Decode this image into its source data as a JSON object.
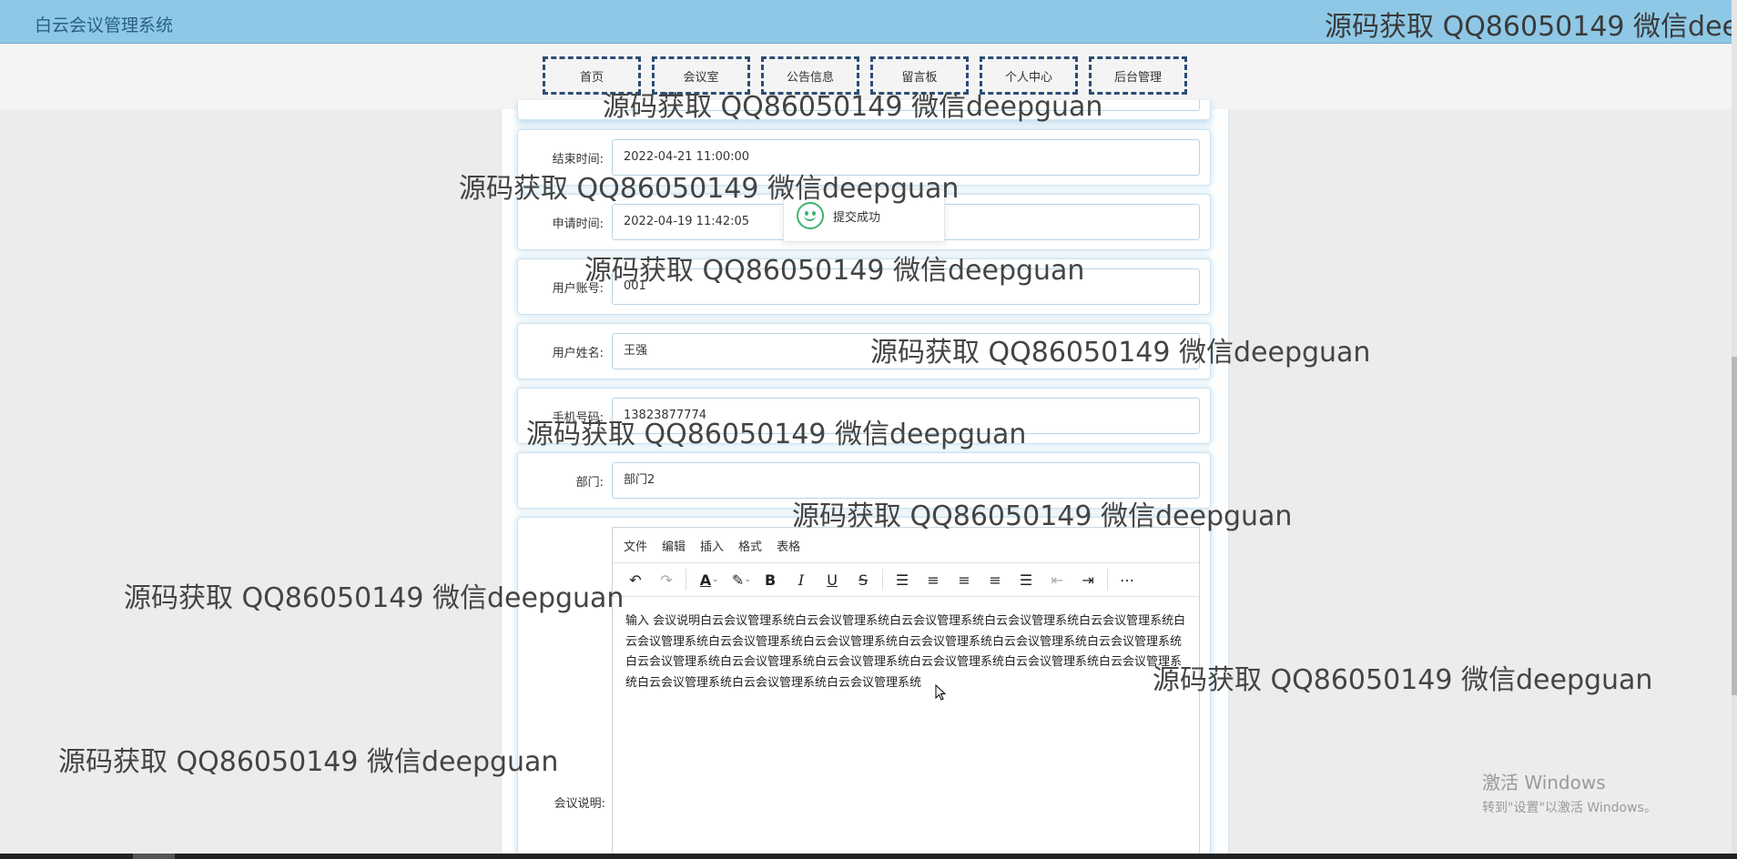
{
  "header": {
    "title": "白云会议管理系统"
  },
  "nav": {
    "items": [
      "首页",
      "会议室",
      "公告信息",
      "留言板",
      "个人中心",
      "后台管理"
    ]
  },
  "form": {
    "fields": [
      {
        "label": "结束时间:",
        "value": "2022-04-21 11:00:00"
      },
      {
        "label": "申请时间:",
        "value": "2022-04-19 11:42:05"
      },
      {
        "label": "用户账号:",
        "value": "001"
      },
      {
        "label": "用户姓名:",
        "value": "王强"
      },
      {
        "label": "手机号码:",
        "value": "13823877774"
      },
      {
        "label": "部门:",
        "value": "部门2"
      }
    ],
    "editor_label": "会议说明:"
  },
  "editor": {
    "menu": [
      "文件",
      "编辑",
      "插入",
      "格式",
      "表格"
    ],
    "content": "输入 会议说明白云会议管理系统白云会议管理系统白云会议管理系统白云会议管理系统白云会议管理系统白云会议管理系统白云会议管理系统白云会议管理系统白云会议管理系统白云会议管理系统白云会议管理系统白云会议管理系统白云会议管理系统白云会议管理系统白云会议管理系统白云会议管理系统白云会议管理系统白云会议管理系统白云会议管理系统白云会议管理系统"
  },
  "toast": {
    "message": "提交成功"
  },
  "watermark": {
    "text": "源码获取 QQ86050149 微信deepguan",
    "top_text": "源码获取 QQ86050149 微信dee"
  },
  "windows_activation": {
    "line1": "激活 Windows",
    "line2": "转到\"设置\"以激活 Windows。"
  }
}
